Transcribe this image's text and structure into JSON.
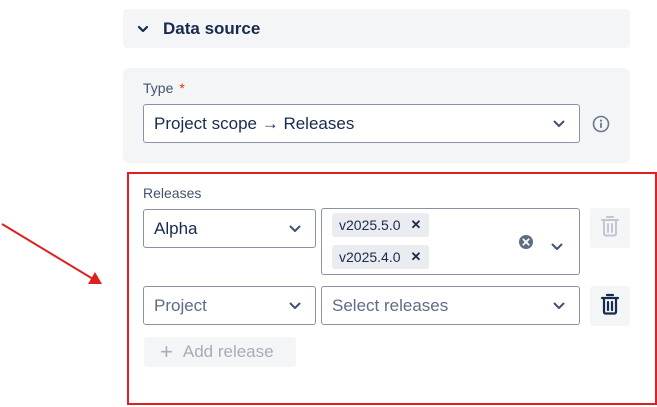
{
  "section": {
    "title": "Data source",
    "icon": "chevron-down-icon"
  },
  "type_field": {
    "label": "Type",
    "required_mark": "*",
    "value": "Project scope → Releases"
  },
  "releases": {
    "label": "Releases",
    "rows": [
      {
        "project": "Alpha",
        "selected": [
          "v2025.5.0",
          "v2025.4.0"
        ],
        "tag_remove_glyph": "✕",
        "delete_enabled": false
      },
      {
        "project_placeholder": "Project",
        "releases_placeholder": "Select releases",
        "delete_enabled": true
      }
    ],
    "add_label": "Add release",
    "add_enabled": false
  },
  "colors": {
    "highlight": "#e02020",
    "required": "#de350b",
    "text": "#172b4d",
    "panel": "#f4f5f7",
    "disabled": "#a5adba"
  }
}
